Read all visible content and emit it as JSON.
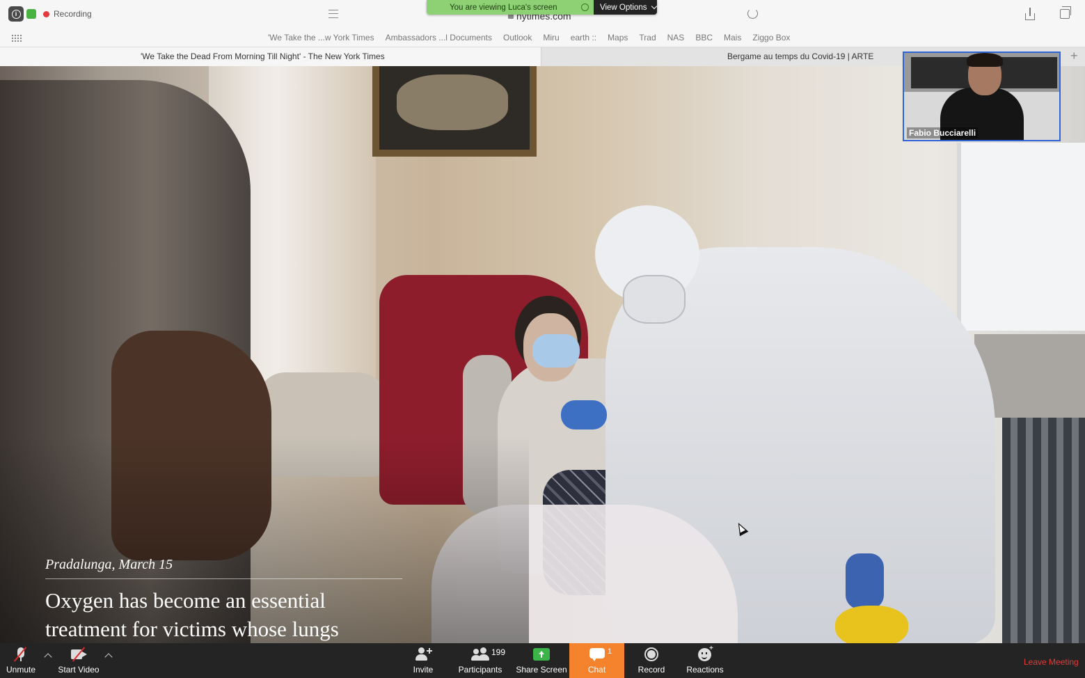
{
  "recording": {
    "label": "Recording"
  },
  "view_banner": {
    "message": "You are viewing Luca's screen",
    "options_label": "View Options"
  },
  "browser": {
    "address": "nytimes.com",
    "bookmarks": [
      "'We Take the ...w York Times",
      "Ambassadors ...l Documents",
      "Outlook",
      "Miru",
      "earth ::",
      "Maps",
      "Trad",
      "NAS",
      "BBC",
      "Mais",
      "Ziggo Box"
    ],
    "tabs": [
      {
        "label": "'We Take the Dead From Morning Till Night' - The New York Times"
      },
      {
        "label": "Bergame au temps du Covid-19 | ARTE"
      }
    ]
  },
  "article": {
    "place": "Pradalunga, March 15",
    "caption": "Oxygen has become an essential treatment for victims whose lungs"
  },
  "participant_tile": {
    "name": "Fabio Bucciarelli"
  },
  "controls": {
    "unmute": "Unmute",
    "start_video": "Start Video",
    "invite": "Invite",
    "participants": "Participants",
    "participants_count": "199",
    "share_screen": "Share Screen",
    "chat": "Chat",
    "chat_unread": "1",
    "record": "Record",
    "reactions": "Reactions",
    "leave": "Leave Meeting"
  },
  "colors": {
    "share_green": "#3bb54a",
    "chat_orange": "#f5832e",
    "leave_red": "#e33b3b",
    "banner_green": "#8dd174"
  }
}
